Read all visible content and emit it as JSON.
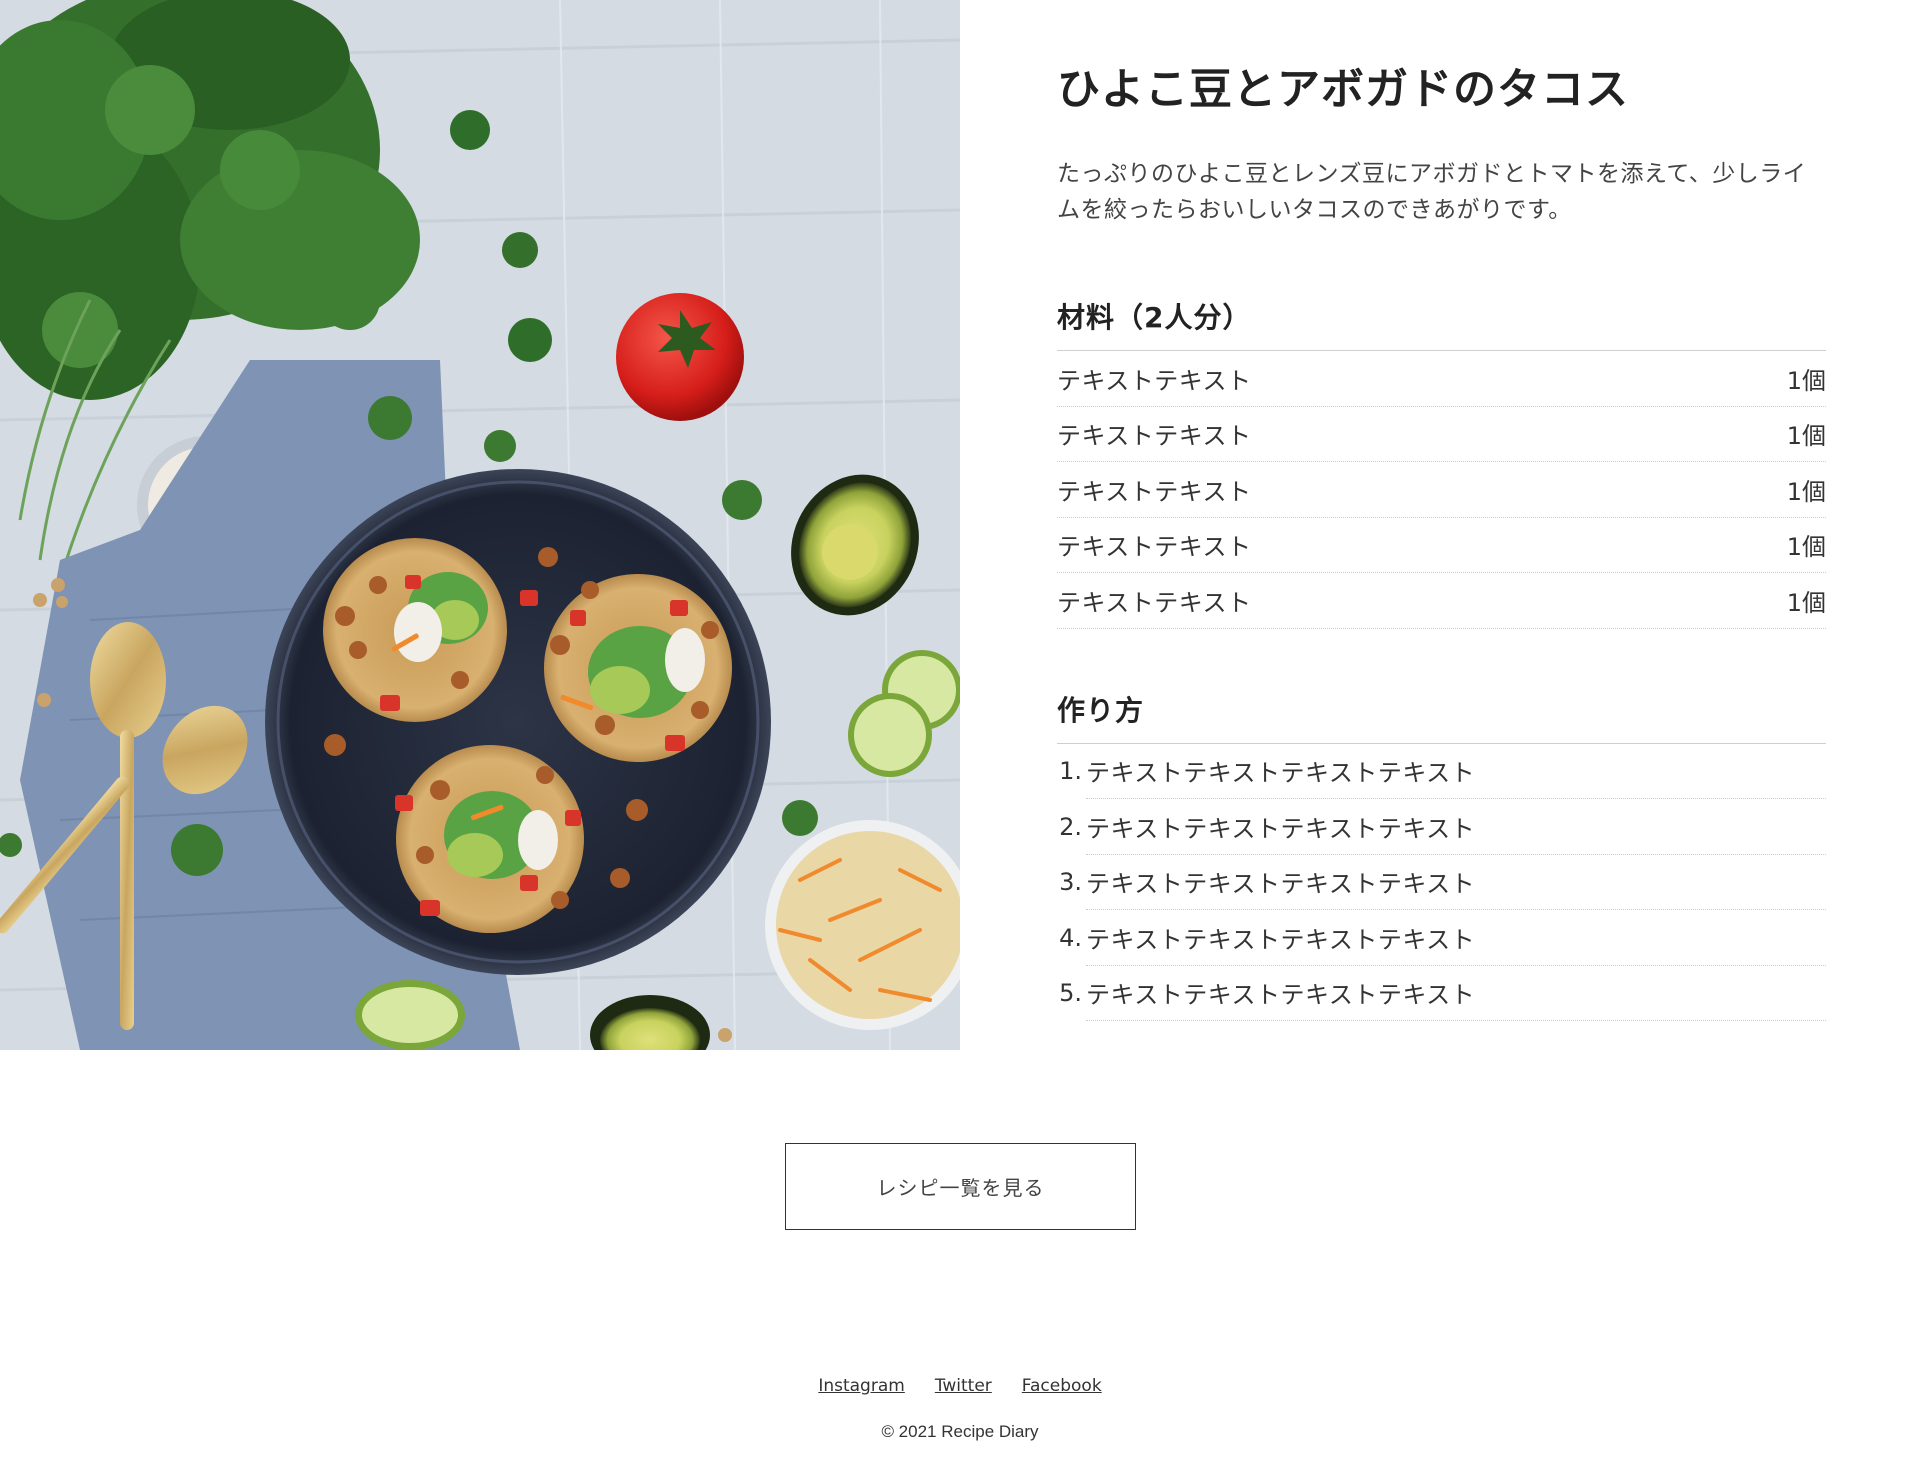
{
  "recipe": {
    "title": "ひよこ豆とアボガドのタコス",
    "description": "たっぷりのひよこ豆とレンズ豆にアボガドとトマトを添えて、少しライムを絞ったらおいしいタコスのできあがりです。",
    "image_alt": "tacos-photo"
  },
  "ingredients": {
    "heading": "材料（2人分）",
    "items": [
      {
        "name": "テキストテキスト",
        "qty": "1個"
      },
      {
        "name": "テキストテキスト",
        "qty": "1個"
      },
      {
        "name": "テキストテキスト",
        "qty": "1個"
      },
      {
        "name": "テキストテキスト",
        "qty": "1個"
      },
      {
        "name": "テキストテキスト",
        "qty": "1個"
      }
    ]
  },
  "steps": {
    "heading": "作り方",
    "items": [
      {
        "num": "1.",
        "text": "テキストテキストテキストテキスト"
      },
      {
        "num": "2.",
        "text": "テキストテキストテキストテキスト"
      },
      {
        "num": "3.",
        "text": "テキストテキストテキストテキスト"
      },
      {
        "num": "4.",
        "text": "テキストテキストテキストテキスト"
      },
      {
        "num": "5.",
        "text": "テキストテキストテキストテキスト"
      }
    ]
  },
  "button": {
    "label": "レシピ一覧を見る"
  },
  "footer": {
    "links": [
      "Instagram",
      "Twitter",
      "Facebook"
    ],
    "copyright": "© 2021 Recipe Diary"
  }
}
